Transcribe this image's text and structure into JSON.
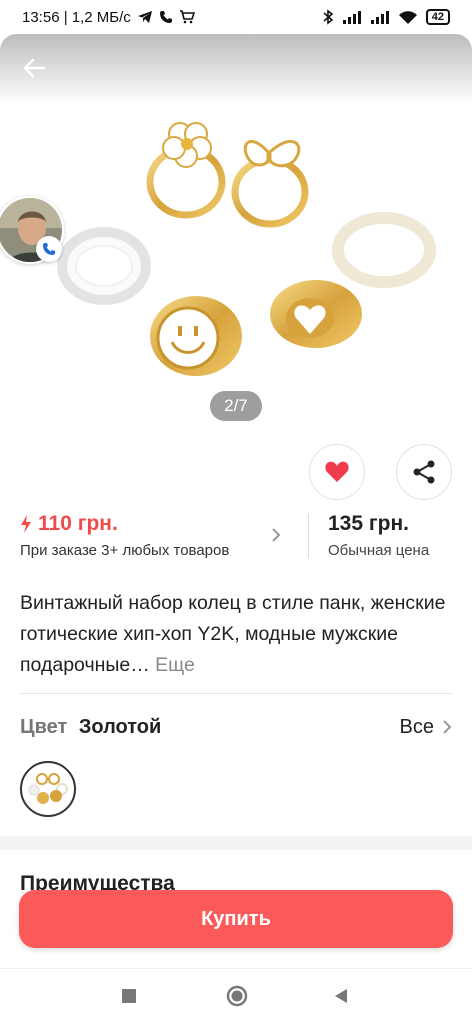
{
  "status": {
    "time_speed": "13:56 | 1,2 МБ/с",
    "battery": "42"
  },
  "gallery": {
    "counter": "2/7"
  },
  "price": {
    "promo": "110 грн.",
    "promo_note": "При заказе 3+ любых товаров",
    "regular": "135 грн.",
    "regular_note": "Обычная цена"
  },
  "product": {
    "title": "Винтажный набор колец в стиле панк, женские готические хип-хоп Y2K, модные мужские подарочные…",
    "more": "Еще"
  },
  "color": {
    "label": "Цвет",
    "value": "Золотой",
    "all": "Все"
  },
  "sections": {
    "advantages": "Преимущества"
  },
  "actions": {
    "buy": "Купить"
  },
  "colors": {
    "accent": "#fb5a5a",
    "promo": "#ef4b4b"
  }
}
